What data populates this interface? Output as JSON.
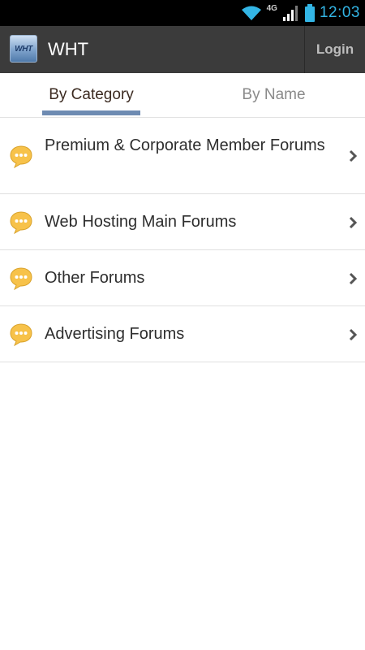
{
  "status_bar": {
    "time": "12:03",
    "network": "4G",
    "icons": [
      "wifi-icon",
      "signal-icon",
      "battery-icon"
    ]
  },
  "action_bar": {
    "logo_text": "WHT",
    "title": "WHT",
    "login_label": "Login"
  },
  "tabs": [
    {
      "label": "By Category",
      "selected": true
    },
    {
      "label": "By Name",
      "selected": false
    }
  ],
  "forums": [
    {
      "label": "Premium & Corporate Member Forums",
      "icon": "speech-bubble-icon"
    },
    {
      "label": "Web Hosting Main Forums",
      "icon": "speech-bubble-icon"
    },
    {
      "label": "Other Forums",
      "icon": "speech-bubble-icon"
    },
    {
      "label": "Advertising Forums",
      "icon": "speech-bubble-icon"
    }
  ],
  "colors": {
    "status_accent": "#33b5e5",
    "action_bar_bg": "#3b3b3b",
    "tab_indicator": "#6e8bb2",
    "icon_yellow": "#f7c24a"
  }
}
